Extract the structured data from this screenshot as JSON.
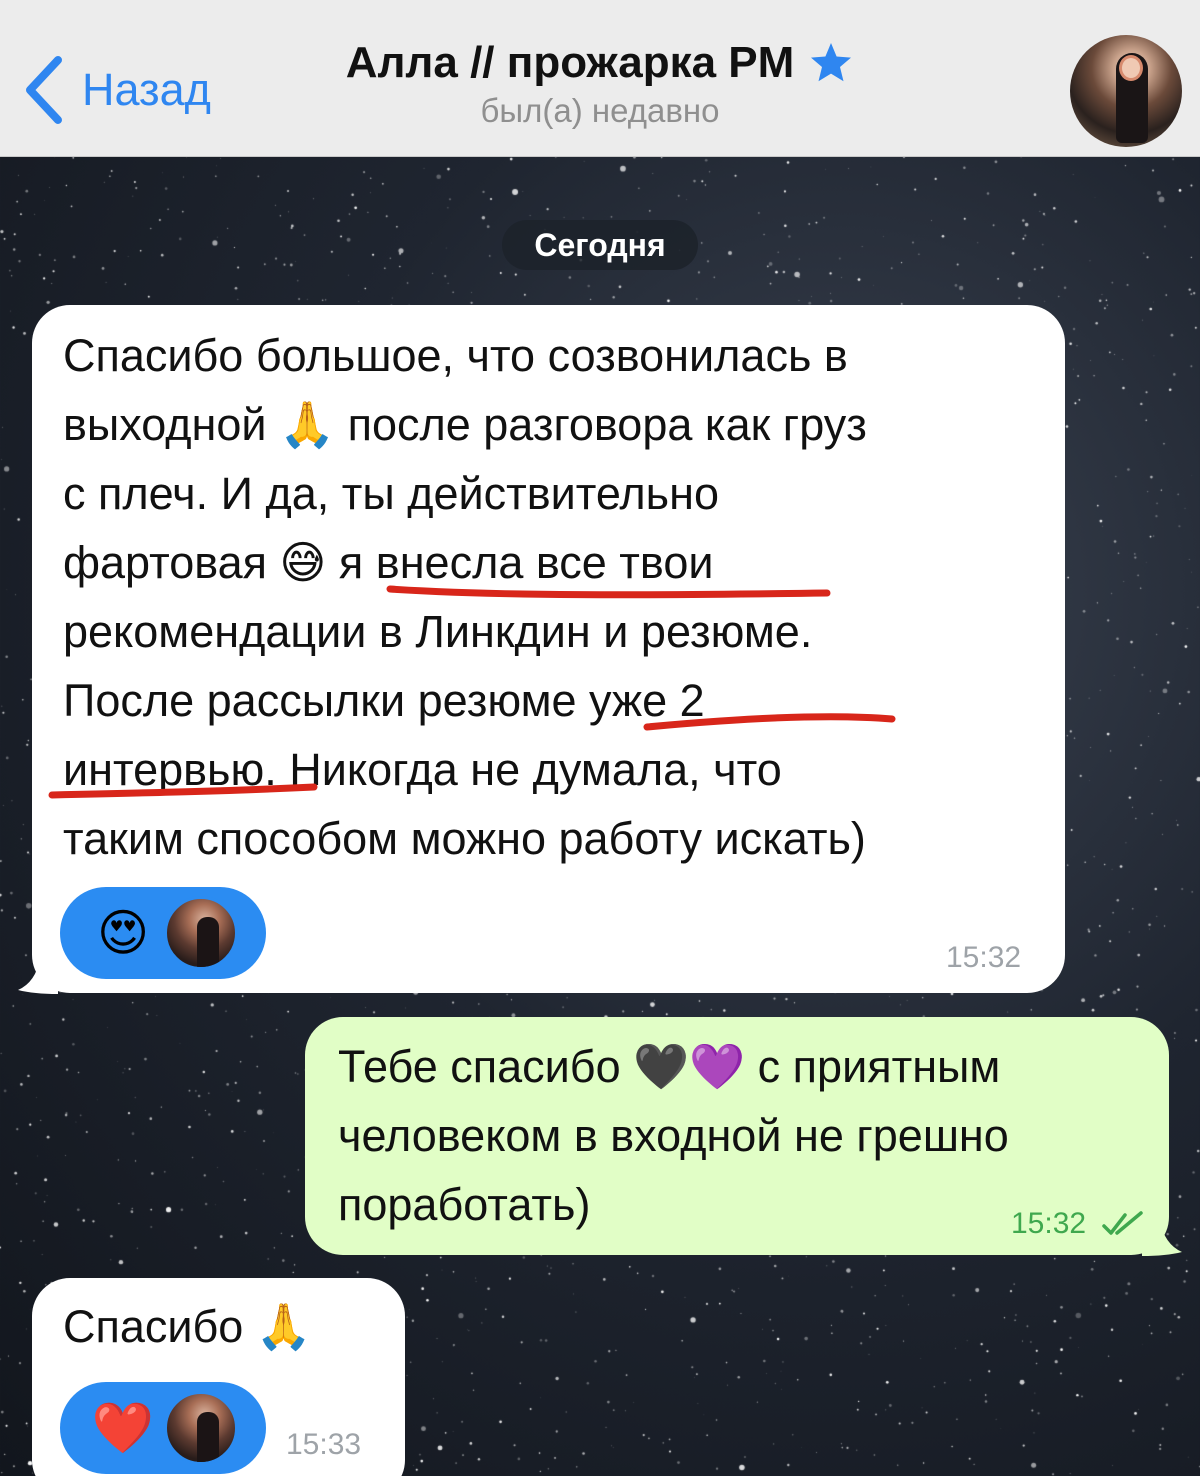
{
  "header": {
    "back_label": "Назад",
    "title": "Алла // прожарка PM",
    "status": "был(а) недавно"
  },
  "date_separator": "Сегодня",
  "messages": [
    {
      "direction": "incoming",
      "text": "Спасибо большое, что созвонилась в\nвыходной 🙏 после разговора как груз\nс плеч. И да, ты действительно\nфартовая 😅 я внесла все твои\nрекомендации в Линкдин и резюме.\nПосле рассылки резюме уже 2\nинтервью. Никогда не думала, что\nтаким способом можно работу искать)",
      "time": "15:32",
      "reaction": "😍"
    },
    {
      "direction": "outgoing",
      "text": "Тебе спасибо 🖤💜 с приятным\nчеловеком в входной не грешно\nпоработать)",
      "time": "15:32"
    },
    {
      "direction": "incoming",
      "text": "Спасибо 🙏",
      "time": "15:33",
      "reaction": "❤️"
    }
  ],
  "colors": {
    "accent": "#2f86f0",
    "incoming_bubble": "#ffffff",
    "outgoing_bubble": "#e1fec6",
    "reaction_bg": "#2b8cf2",
    "annotation_underline": "#d8261a",
    "outgoing_time": "#3fa84e"
  },
  "icons": {
    "back": "chevron-left-icon",
    "title_badge": "star-icon",
    "read_status": "double-check-icon"
  }
}
